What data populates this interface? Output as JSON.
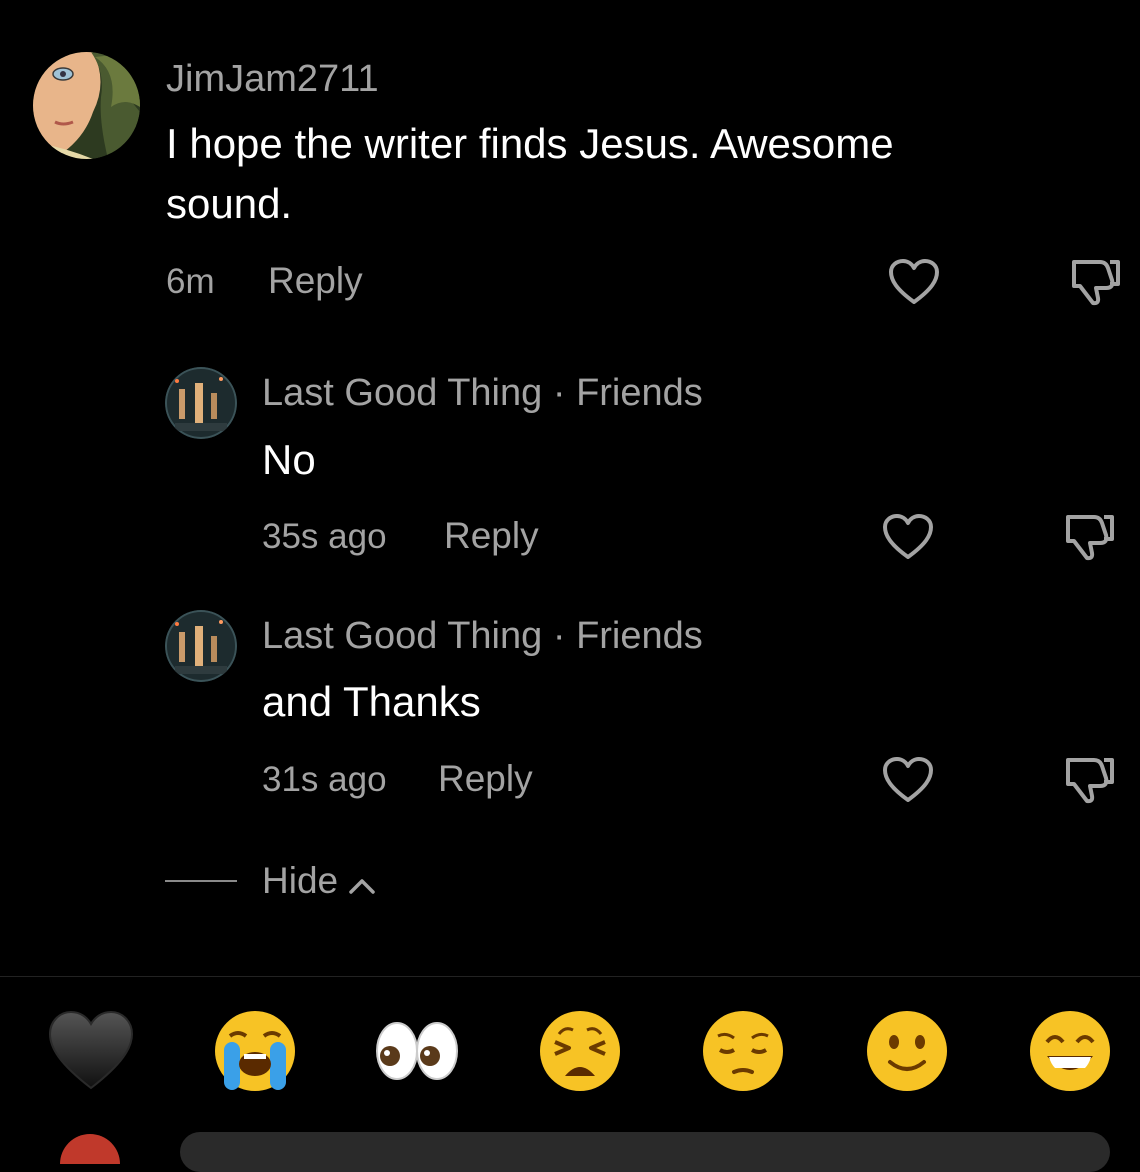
{
  "comments": [
    {
      "username": "JimJam2711",
      "text": "I hope the writer finds Jesus. Awesome sound.",
      "time": "6m",
      "reply_label": "Reply",
      "like_icon": "heart-outline-icon",
      "dislike_icon": "thumbs-down-icon"
    }
  ],
  "replies": [
    {
      "username": "Last Good Thing",
      "relation_separator": "·",
      "relation": "Friends",
      "text": "No",
      "time": "35s ago",
      "reply_label": "Reply"
    },
    {
      "username": "Last Good Thing",
      "relation_separator": "·",
      "relation": "Friends",
      "text": "and Thanks",
      "time": "31s ago",
      "reply_label": "Reply"
    }
  ],
  "hide_label": "Hide",
  "emoji_bar": [
    {
      "name": "black-heart",
      "glyph": "🖤"
    },
    {
      "name": "loudly-crying-face",
      "glyph": "😭"
    },
    {
      "name": "eyes",
      "glyph": "👀"
    },
    {
      "name": "weary-face",
      "glyph": "😩"
    },
    {
      "name": "pensive-face",
      "glyph": "😔"
    },
    {
      "name": "slightly-smiling-face",
      "glyph": "🙂"
    },
    {
      "name": "grinning-face-with-smiling-eyes",
      "glyph": "😁"
    }
  ],
  "colors": {
    "background": "#000000",
    "secondary_text": "#a3a3a3",
    "primary_text": "#ffffff",
    "emoji_yellow": "#f7c325"
  }
}
